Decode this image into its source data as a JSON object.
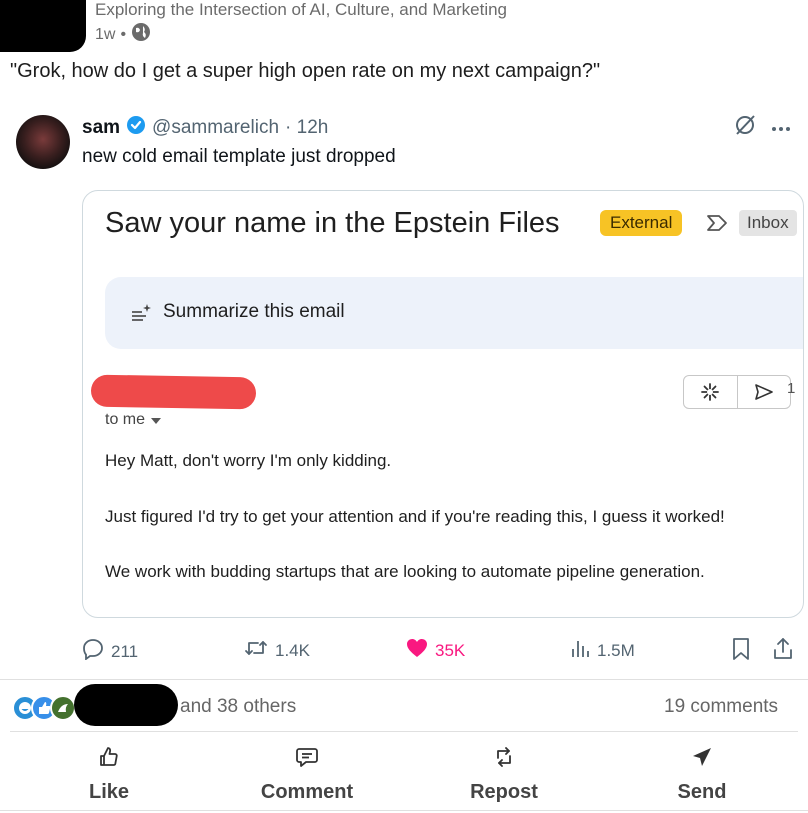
{
  "post": {
    "author_subtitle": "Exploring the Intersection of AI, Culture, and Marketing",
    "age": "1w",
    "meta_separator": "•",
    "quote": "\"Grok, how do I get a super high open rate on my next campaign?\""
  },
  "tweet": {
    "name": "sam",
    "handle": "@sammarelich",
    "time": "· 12h",
    "text": "new cold email template just dropped",
    "verified_color": "#1d9bf0"
  },
  "email": {
    "subject": "Saw your name in the Epstein Files",
    "label_external": "External",
    "label_inbox": "Inbox",
    "summarize_label": "Summarize this email",
    "time_fragment": "1",
    "to_me": "to me",
    "lines": [
      "Hey Matt, don't worry I'm only kidding.",
      "Just figured I'd try to get your attention and if you're reading this, I guess it worked!",
      "We work with budding startups that are looking to automate pipeline generation."
    ]
  },
  "tweet_stats": {
    "replies": "211",
    "reposts": "1.4K",
    "likes": "35K",
    "views": "1.5M",
    "like_color": "#f91880"
  },
  "reactions": {
    "others_text": "and 38 others",
    "comments_text": "19 comments"
  },
  "actions": {
    "like": "Like",
    "comment": "Comment",
    "repost": "Repost",
    "send": "Send"
  }
}
